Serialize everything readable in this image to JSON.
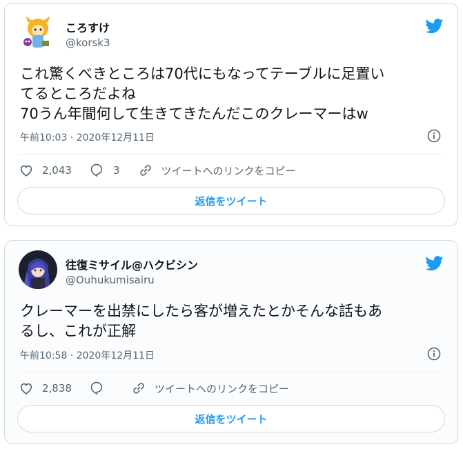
{
  "colors": {
    "accent": "#1d9bf0",
    "text": "#0f1419",
    "muted": "#536471",
    "border": "#cfd9de"
  },
  "tweets": [
    {
      "name": "ころすけ",
      "handle": "@korsk3",
      "lines": [
        "これ驚くべきところは70代にもなってテーブルに足置い",
        "てるところだよね",
        "70うん年間何して生きてきたんだこのクレーマーはw"
      ],
      "timestamp": "午前10:03 · 2020年12月11日",
      "likes": "2,043",
      "replies": "3",
      "copy_link_label": "ツイートへのリンクをコピー",
      "reply_button": "返信をツイート"
    },
    {
      "name": "往復ミサイル@ハクビシン",
      "handle": "@Ouhukumisairu",
      "lines": [
        "クレーマーを出禁にしたら客が増えたとかそんな話もあ",
        "るし、これが正解"
      ],
      "timestamp": "午前10:58 · 2020年12月11日",
      "likes": "2,838",
      "replies": "",
      "copy_link_label": "ツイートへのリンクをコピー",
      "reply_button": "返信をツイート"
    }
  ],
  "icons": [
    "twitter-bird-icon",
    "info-icon",
    "heart-icon",
    "reply-icon",
    "link-icon"
  ]
}
